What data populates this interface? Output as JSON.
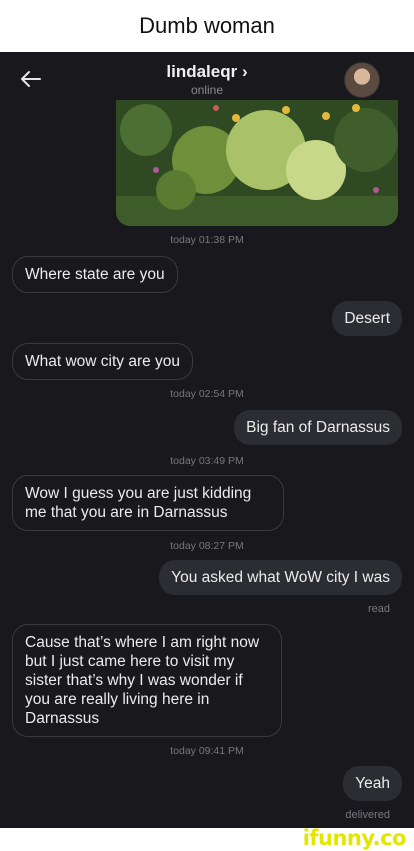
{
  "caption": "Dumb woman",
  "header": {
    "back_icon": "arrow-left-icon",
    "contact_name": "lindaleqr ›",
    "status": "online"
  },
  "messages": {
    "ts1": "today 01:38 PM",
    "m1": "Where state are you",
    "m2": "Desert",
    "m3": "What wow city are you",
    "ts2": "today 02:54 PM",
    "m4": "Big fan of Darnassus",
    "ts3": "today 03:49 PM",
    "m5": "Wow I guess you are just kidding me that you are in Darnassus",
    "ts4": "today 08:27 PM",
    "m6": "You asked what WoW city I was",
    "read": "read",
    "m7": "Cause that’s where I am right now but I just came here to visit my sister that’s why I was wonder if you are really living here in Darnassus",
    "ts5": "today 09:41 PM",
    "m8": "Yeah",
    "delivered": "delivered"
  },
  "watermark": "ifunny.co",
  "colors": {
    "brand": "#e4e600",
    "bubble_out": "#2c2c33",
    "screen_bg": "#18181d"
  }
}
